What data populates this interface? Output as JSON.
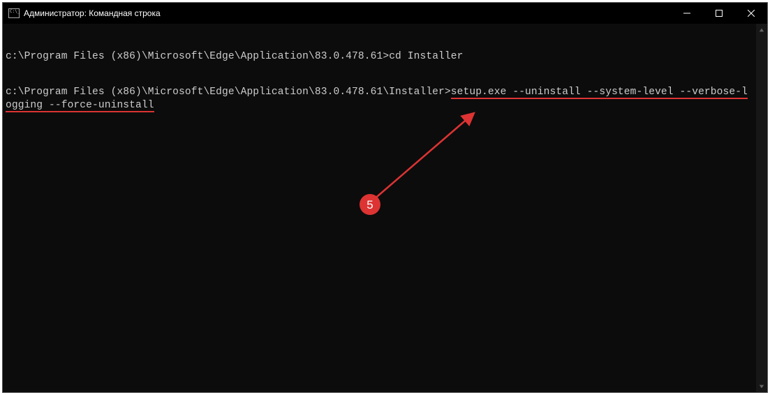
{
  "window": {
    "title": "Администратор: Командная строка"
  },
  "terminal": {
    "line1_prompt": "c:\\Program Files (x86)\\Microsoft\\Edge\\Application\\83.0.478.61>",
    "line1_cmd": "cd Installer",
    "line2_prompt": "c:\\Program Files (x86)\\Microsoft\\Edge\\Application\\83.0.478.61\\Installer>",
    "line2_cmd_part1": "setup.exe --uninstall --system-level --verbose-l",
    "line2_cmd_part2": "ogging --force-uninstall"
  },
  "annotation": {
    "badge_number": "5"
  }
}
